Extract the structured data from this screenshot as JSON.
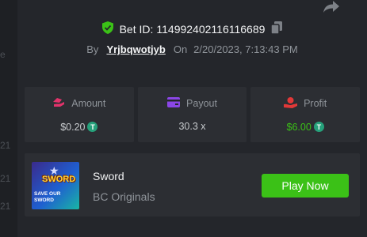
{
  "bet": {
    "id_label": "Bet ID:",
    "id_value": "114992402116116689"
  },
  "byline": {
    "by_label": "By",
    "user": "Yrjbqwotjyb",
    "on_label": "On",
    "datetime": "2/20/2023, 7:13:43 PM"
  },
  "stats": {
    "amount": {
      "label": "Amount",
      "value": "$0.20"
    },
    "payout": {
      "label": "Payout",
      "value": "30.3 x"
    },
    "profit": {
      "label": "Profit",
      "value": "$6.00"
    }
  },
  "game": {
    "name": "Sword",
    "provider": "BC Originals",
    "play_label": "Play Now",
    "thumb_title": "SWORD",
    "thumb_subtitle": "SAVE OUR SWORD"
  },
  "background": {
    "fragments": [
      "e",
      "21",
      "21",
      "21"
    ]
  },
  "colors": {
    "accent_green": "#3bc117",
    "amount_icon": "#e2336b",
    "payout_icon": "#8b46e6",
    "profit_icon": "#e23838",
    "coin": "#26a17b"
  },
  "icons": {
    "verified": "shield-check-icon",
    "copy": "copy-icon",
    "share": "share-icon",
    "amount": "amount-icon",
    "payout": "wallet-icon",
    "profit": "profit-icon",
    "coin": "usdt-coin-icon"
  }
}
